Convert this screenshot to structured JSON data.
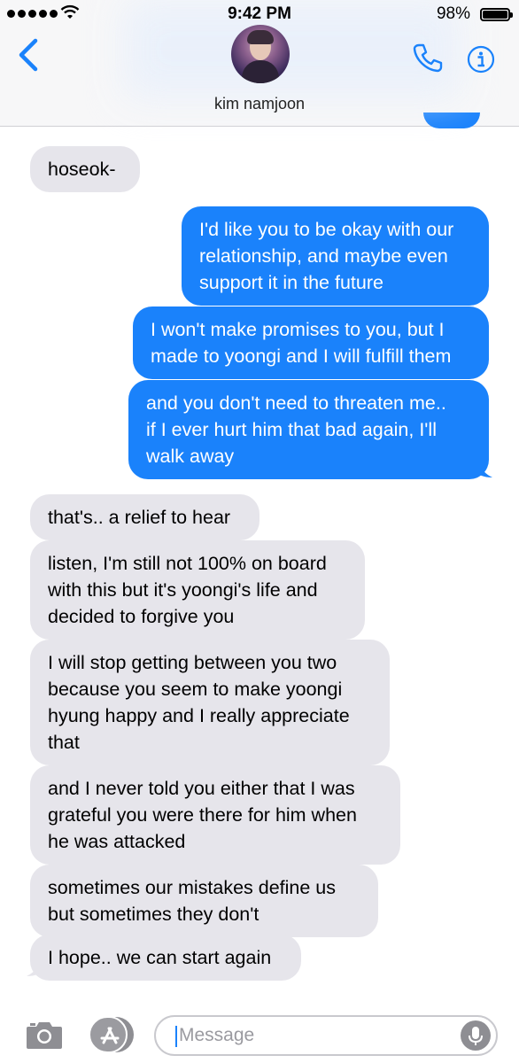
{
  "status_bar": {
    "time": "9:42 PM",
    "battery": "98%"
  },
  "header": {
    "contact_name": "kim namjoon"
  },
  "messages": [
    {
      "side": "in",
      "lines": [
        "hoseok-"
      ]
    },
    {
      "side": "out",
      "lines": [
        "I'd like you to be okay with our",
        "relationship, and maybe even",
        "support it in the future"
      ]
    },
    {
      "side": "out",
      "lines": [
        "I won't make promises to you, but I",
        "made to yoongi and I will fulfill them"
      ]
    },
    {
      "side": "out",
      "lines": [
        "and you don't need to threaten me..",
        "if I ever hurt him that bad again, I'll",
        "walk away"
      ]
    },
    {
      "side": "in",
      "lines": [
        "that's.. a relief to hear"
      ]
    },
    {
      "side": "in",
      "lines": [
        "listen, I'm still not 100% on board",
        "with this but it's yoongi's life and",
        "decided to forgive you"
      ]
    },
    {
      "side": "in",
      "lines": [
        "I will stop getting between you two",
        "because you seem to make yoongi",
        "hyung happy and I really appreciate",
        "that"
      ]
    },
    {
      "side": "in",
      "lines": [
        "and I never told you either that I was",
        "grateful you were there for him when",
        "he was attacked"
      ]
    },
    {
      "side": "in",
      "lines": [
        "sometimes our mistakes define us",
        "but sometimes they don't"
      ]
    },
    {
      "side": "in",
      "lines": [
        "I hope.. we can start again"
      ]
    }
  ],
  "input": {
    "placeholder": "Message"
  },
  "colors": {
    "accent": "#1a82fb",
    "incoming_bubble": "#e6e5eb",
    "outgoing_bubble": "#1a82fb"
  },
  "icons": [
    "back-chevron-icon",
    "phone-icon",
    "info-icon",
    "camera-icon",
    "app-store-icon",
    "microphone-icon",
    "wifi-icon",
    "battery-icon"
  ]
}
